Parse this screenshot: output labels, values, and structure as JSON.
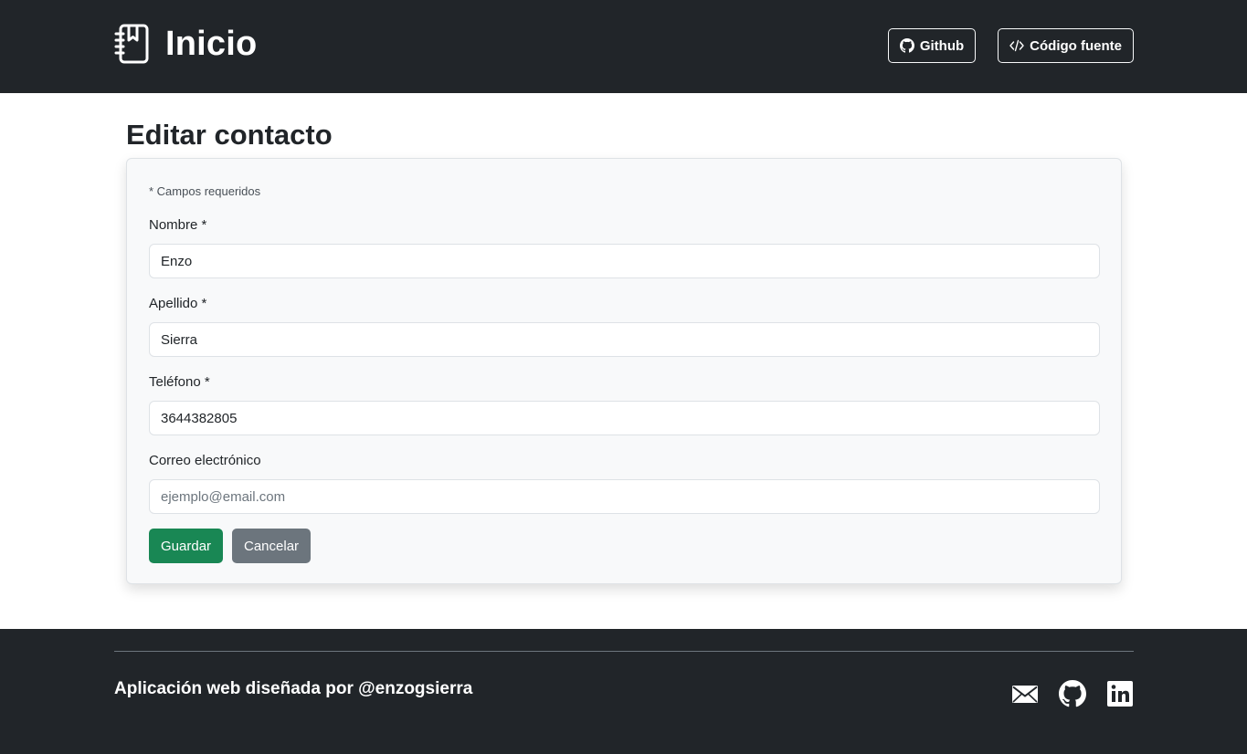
{
  "header": {
    "title": "Inicio",
    "brand_icon": "journal-bookmark-icon",
    "github_label": "Github",
    "source_label": "Código fuente"
  },
  "main": {
    "page_title": "Editar contacto",
    "required_note": "* Campos requeridos",
    "fields": [
      {
        "label": "Nombre *",
        "value": "Enzo",
        "placeholder": ""
      },
      {
        "label": "Apellido *",
        "value": "Sierra",
        "placeholder": ""
      },
      {
        "label": "Teléfono *",
        "value": "3644382805",
        "placeholder": ""
      },
      {
        "label": "Correo electrónico",
        "value": "",
        "placeholder": "ejemplo@email.com"
      }
    ],
    "save_label": "Guardar",
    "cancel_label": "Cancelar"
  },
  "footer": {
    "credit": "Aplicación web diseñada por @enzogsierra",
    "icons": [
      "envelope-icon",
      "github-icon",
      "linkedin-icon"
    ]
  },
  "colors": {
    "header_bg": "#212529",
    "card_bg": "#f8f9fa",
    "save_button": "#198754",
    "cancel_button": "#6c757d"
  }
}
